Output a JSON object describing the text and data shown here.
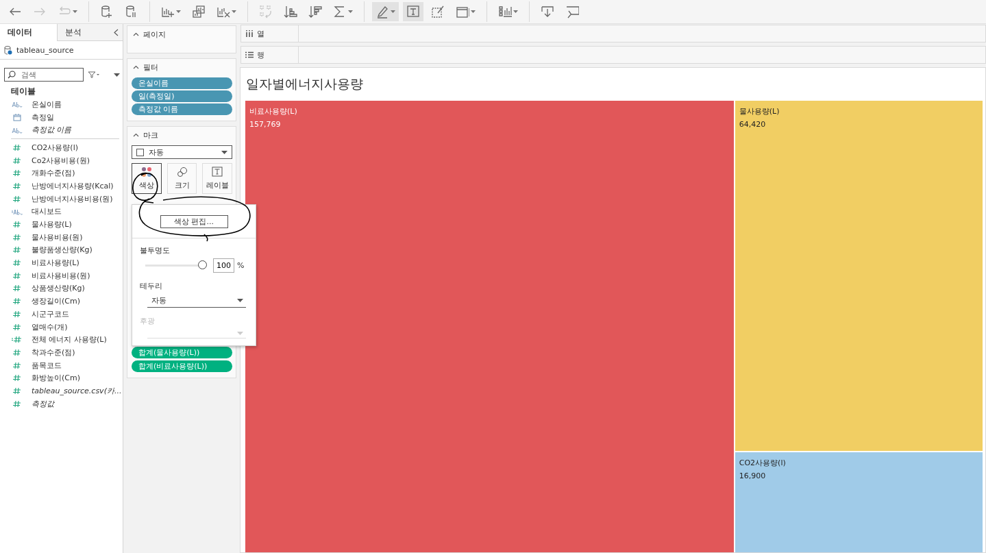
{
  "toolbar": [
    [
      {
        "kind": "back",
        "disabled": false,
        "dropdown": false,
        "selected": false
      },
      {
        "kind": "forward",
        "disabled": true,
        "dropdown": false,
        "selected": false
      },
      {
        "kind": "redo",
        "disabled": true,
        "dropdown": true,
        "selected": false
      }
    ],
    [
      {
        "kind": "new-datasource",
        "disabled": false,
        "dropdown": false,
        "selected": false
      },
      {
        "kind": "pause-datasource",
        "disabled": false,
        "dropdown": false,
        "selected": false
      }
    ],
    [
      {
        "kind": "new-sheet",
        "disabled": false,
        "dropdown": true,
        "selected": false
      },
      {
        "kind": "duplicate-sheet",
        "disabled": false,
        "dropdown": false,
        "selected": false
      },
      {
        "kind": "clear-sheet",
        "disabled": false,
        "dropdown": true,
        "selected": false
      }
    ],
    [
      {
        "kind": "swap",
        "disabled": true,
        "dropdown": false,
        "selected": false
      },
      {
        "kind": "sort-asc",
        "disabled": false,
        "dropdown": false,
        "selected": false
      },
      {
        "kind": "sort-desc",
        "disabled": false,
        "dropdown": false,
        "selected": false
      },
      {
        "kind": "sum",
        "disabled": false,
        "dropdown": true,
        "selected": false
      }
    ],
    [
      {
        "kind": "highlight",
        "disabled": false,
        "dropdown": true,
        "selected": true
      },
      {
        "kind": "text",
        "disabled": false,
        "dropdown": false,
        "selected": true
      },
      {
        "kind": "format",
        "disabled": false,
        "dropdown": false,
        "selected": false
      },
      {
        "kind": "fit",
        "disabled": false,
        "dropdown": true,
        "selected": false
      }
    ],
    [
      {
        "kind": "show-me",
        "disabled": false,
        "dropdown": true,
        "selected": false
      }
    ],
    [
      {
        "kind": "download",
        "disabled": false,
        "dropdown": false,
        "selected": false
      },
      {
        "kind": "presentation",
        "disabled": false,
        "dropdown": false,
        "selected": false
      }
    ]
  ],
  "sidebar": {
    "tabs": [
      {
        "label": "데이터",
        "selected": true
      },
      {
        "label": "분석",
        "selected": false
      }
    ],
    "datasource": "tableau_source",
    "search": {
      "placeholder": "검색"
    },
    "section": "테이블",
    "fields": [
      {
        "kind": "abc",
        "label": "온실이름",
        "italic": false
      },
      {
        "kind": "date",
        "label": "측정일",
        "italic": false
      },
      {
        "kind": "abc",
        "label": "측정값 이름",
        "italic": true
      },
      {
        "kind": "divider"
      },
      {
        "kind": "measure",
        "label": "CO2사용량(l)",
        "italic": false
      },
      {
        "kind": "measure",
        "label": "Co2사용비용(원)",
        "italic": false
      },
      {
        "kind": "measure",
        "label": "개화수준(점)",
        "italic": false
      },
      {
        "kind": "measure",
        "label": "난방에너지사용량(Kcal)",
        "italic": false
      },
      {
        "kind": "measure",
        "label": "난방에너지사용비용(원)",
        "italic": false
      },
      {
        "kind": "calc-abc",
        "label": "대시보드",
        "italic": false
      },
      {
        "kind": "measure",
        "label": "물사용량(L)",
        "italic": false
      },
      {
        "kind": "measure",
        "label": "물사용비용(원)",
        "italic": false
      },
      {
        "kind": "measure",
        "label": "불량품생산량(Kg)",
        "italic": false
      },
      {
        "kind": "measure",
        "label": "비료사용량(L)",
        "italic": false
      },
      {
        "kind": "measure",
        "label": "비료사용비용(원)",
        "italic": false
      },
      {
        "kind": "measure",
        "label": "상품생산량(Kg)",
        "italic": false
      },
      {
        "kind": "measure",
        "label": "생장길이(Cm)",
        "italic": false
      },
      {
        "kind": "measure",
        "label": "시군구코드",
        "italic": false
      },
      {
        "kind": "measure",
        "label": "열매수(개)",
        "italic": false
      },
      {
        "kind": "calc-measure",
        "label": "전체 에너지 사용량(L)",
        "italic": false
      },
      {
        "kind": "measure",
        "label": "착과수준(점)",
        "italic": false
      },
      {
        "kind": "measure",
        "label": "품목코드",
        "italic": false
      },
      {
        "kind": "measure",
        "label": "화방높이(Cm)",
        "italic": false
      },
      {
        "kind": "measure",
        "label": "tableau_source.csv(카...",
        "italic": true
      },
      {
        "kind": "measure",
        "label": "측정값",
        "italic": true
      }
    ]
  },
  "pages_card": {
    "title": "페이지"
  },
  "filters_card": {
    "title": "필터",
    "pills": [
      "온실이름",
      "일(측정일)",
      "측정값 이름"
    ]
  },
  "marks_card": {
    "title": "마크",
    "mark_type": "자동",
    "buttons": [
      {
        "kind": "color",
        "label": "색상",
        "selected": true
      },
      {
        "kind": "size",
        "label": "크기",
        "selected": false
      },
      {
        "kind": "label",
        "label": "레이블",
        "selected": false
      }
    ],
    "pills": [
      "합계(물사용량(L))",
      "합계(비료사용량(L))"
    ]
  },
  "color_popup": {
    "edit_button": "색상 편집...",
    "opacity_label": "불투명도",
    "opacity": {
      "level": 1
    },
    "opacity_value": "100",
    "percent": "%",
    "border_label": "테두리",
    "border_value": "자동",
    "halo_label": "후광",
    "halo_disabled": true
  },
  "columns_shelf": {
    "label": "열"
  },
  "rows_shelf": {
    "label": "행"
  },
  "view": {
    "title": "일자별에너지사용량",
    "treemap": [
      {
        "label": "비료사용량(L)",
        "value": "157,769",
        "color": "#e15759"
      },
      {
        "label": "물사용량(L)",
        "value": "64,420",
        "color": "#f1ce63"
      },
      {
        "label": "CO2사용량(l)",
        "value": "16,900",
        "color": "#a0cbe8"
      }
    ]
  }
}
